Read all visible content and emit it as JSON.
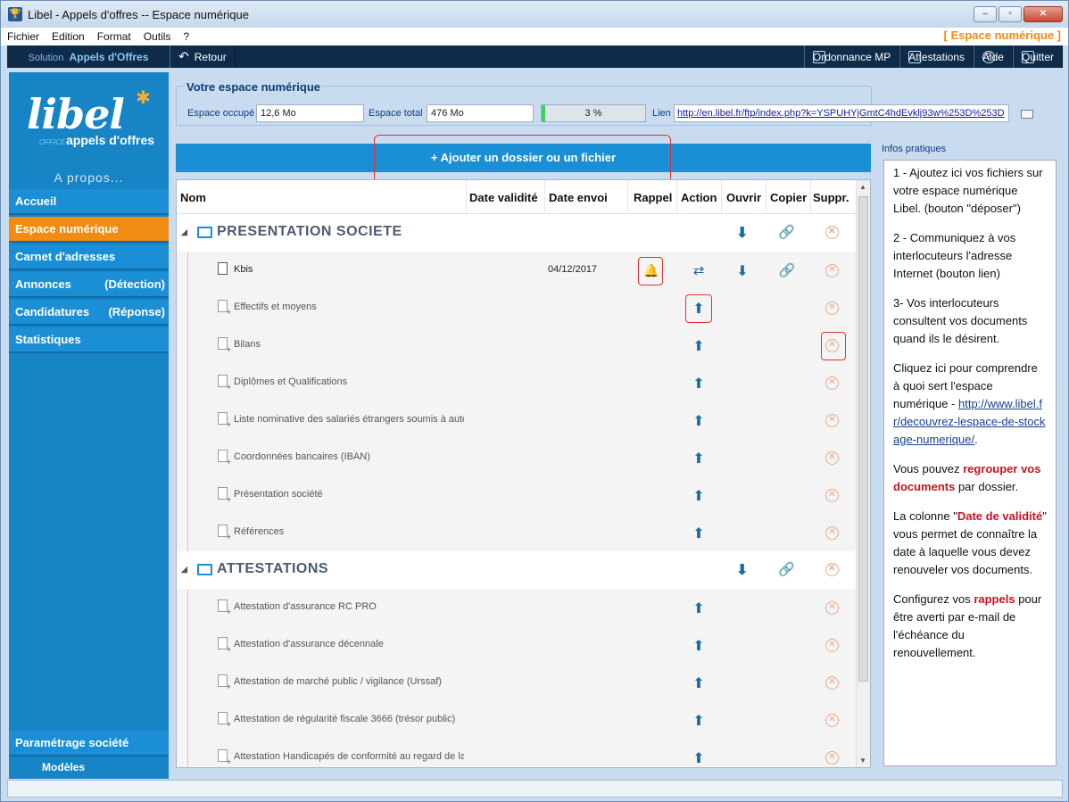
{
  "window": {
    "title": "Libel - Appels d'offres -- Espace numérique",
    "brand": "[ Espace numérique ]"
  },
  "menu": [
    "Fichier",
    "Edition",
    "Format",
    "Outils",
    "?"
  ],
  "toolbar": {
    "solution_label": "Solution",
    "solution_name": "Appels d'Offres",
    "retour": "Retour",
    "ordonnance": "Ordonnance MP",
    "attestations": "Attestations",
    "aide": "Aide",
    "quitter": "Quitter"
  },
  "sidebar": {
    "logo_text": "libel",
    "logo_office": "OFFICE",
    "logo_sub": "appels d'offres",
    "apropos": "A propos...",
    "items": [
      {
        "label": "Accueil",
        "right": "",
        "active": false
      },
      {
        "label": "Espace numérique",
        "right": "",
        "active": true
      },
      {
        "label": "Carnet d'adresses",
        "right": "",
        "active": false
      },
      {
        "label": "Annonces",
        "right": "(Détection)",
        "active": false
      },
      {
        "label": "Candidatures",
        "right": "(Réponse)",
        "active": false
      },
      {
        "label": "Statistiques",
        "right": "",
        "active": false
      }
    ],
    "param": "Paramétrage société",
    "modeles": "Modèles"
  },
  "espace": {
    "legend": "Votre espace numérique",
    "occupe_label": "Espace occupé",
    "occupe_value": "12,6 Mo",
    "total_label": "Espace total",
    "total_value": "476 Mo",
    "progress_text": "3 %",
    "progress_fraction": 0.03,
    "lien_label": "Lien",
    "lien_value": "http://en.libel.fr/ftp/index.php?k=YSPUHYjGmtC4hdEvklj93w%253D%253D"
  },
  "add_button": "+ Ajouter un dossier ou un fichier",
  "table": {
    "headers": {
      "nom": "Nom",
      "validite": "Date validité",
      "envoi": "Date envoi",
      "rappel": "Rappel",
      "action": "Action",
      "ouvrir": "Ouvrir",
      "copier": "Copier",
      "suppr": "Suppr."
    },
    "folders": [
      {
        "name": "PRESENTATION SOCIETE",
        "files": [
          {
            "name": "Kbis",
            "date_envoi": "04/12/2017",
            "has_file": true
          },
          {
            "name": "Effectifs et moyens",
            "date_envoi": "",
            "has_file": false
          },
          {
            "name": "Bilans",
            "date_envoi": "",
            "has_file": false
          },
          {
            "name": "Diplômes et Qualifications",
            "date_envoi": "",
            "has_file": false
          },
          {
            "name": "Liste nominative des salariés étrangers soumis à autor",
            "date_envoi": "",
            "has_file": false
          },
          {
            "name": "Coordonnées bancaires (IBAN)",
            "date_envoi": "",
            "has_file": false
          },
          {
            "name": "Présentation société",
            "date_envoi": "",
            "has_file": false
          },
          {
            "name": "Références",
            "date_envoi": "",
            "has_file": false
          }
        ]
      },
      {
        "name": "ATTESTATIONS",
        "files": [
          {
            "name": "Attestation  d'assurance RC PRO",
            "date_envoi": "",
            "has_file": false
          },
          {
            "name": "Attestation d'assurance décennale",
            "date_envoi": "",
            "has_file": false
          },
          {
            "name": "Attestation de marché public / vigilance (Urssaf)",
            "date_envoi": "",
            "has_file": false
          },
          {
            "name": "Attestation de régularité fiscale 3666 (trésor public)",
            "date_envoi": "",
            "has_file": false
          },
          {
            "name": "Attestation Handicapés de conformité au regard de la",
            "date_envoi": "",
            "has_file": false
          }
        ]
      }
    ]
  },
  "info": {
    "header": "Infos pratiques",
    "p1": "1 - Ajoutez ici vos fichiers sur votre espace numérique Libel. (bouton \"déposer\")",
    "p2": "2 - Communiquez à vos interlocuteurs l'adresse Internet (bouton lien)",
    "p3": "3- Vos interlocuteurs consultent vos documents quand ils le désirent.",
    "p4": "Cliquez ici pour comprendre à quoi sert l'espace numérique -",
    "p4_link": "http://www.libel.fr/decouvrez-lespace-de-stockage-numerique/",
    "p5_a": "Vous pouvez ",
    "p5_b": "regrouper vos documents",
    "p5_c": " par dossier.",
    "p6_a": "La colonne \"",
    "p6_b": "Date de validité",
    "p6_c": "\" vous permet de connaître la date à laquelle vous devez renouveler vos documents.",
    "p7_a": "Configurez vos ",
    "p7_b": "rappels",
    "p7_c": " pour être averti par e-mail de l'échéance du renouvellement."
  },
  "colors": {
    "accent": "#1b8fd6",
    "active": "#f18b12",
    "toolbar": "#0e2c4a",
    "highlight": "#e03030"
  }
}
